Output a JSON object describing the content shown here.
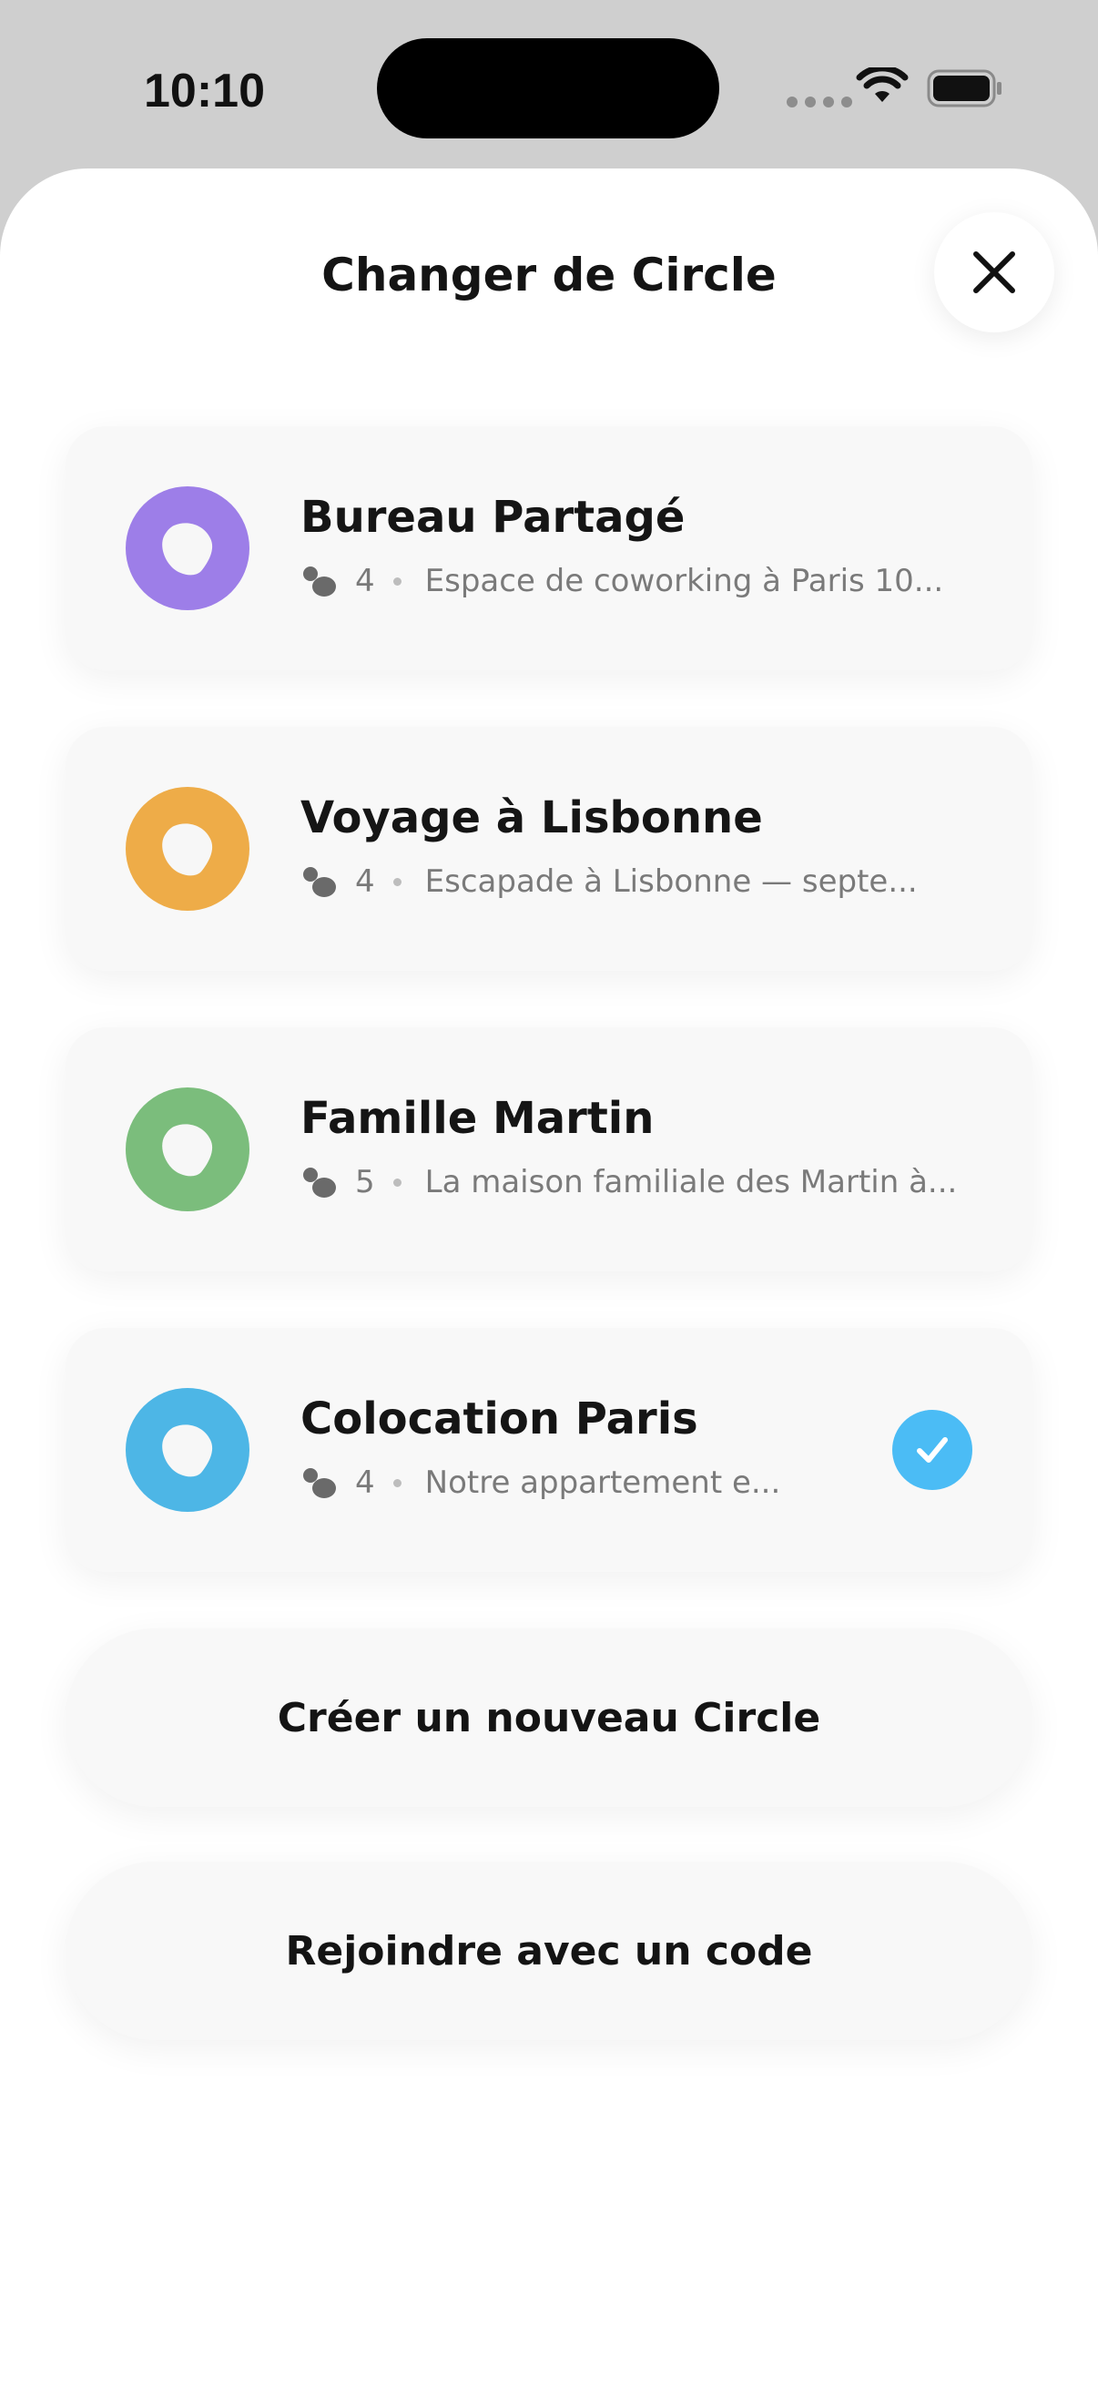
{
  "status_bar": {
    "time": "10:10"
  },
  "sheet": {
    "title": "Changer de Circle",
    "close_icon": "close-icon"
  },
  "circles": [
    {
      "name": "Bureau Partagé",
      "members": "4",
      "description": "Espace de coworking à Paris 10...",
      "color": "#9d7ee8",
      "selected": false
    },
    {
      "name": "Voyage à Lisbonne",
      "members": "4",
      "description": "Escapade à Lisbonne — septe...",
      "color": "#eeac48",
      "selected": false
    },
    {
      "name": "Famille Martin",
      "members": "5",
      "description": "La maison familiale des Martin à...",
      "color": "#7bbd7c",
      "selected": false
    },
    {
      "name": "Colocation Paris",
      "members": "4",
      "description": "Notre appartement e...",
      "color": "#4db6e6",
      "selected": true
    }
  ],
  "actions": {
    "create_label": "Créer un nouveau Circle",
    "join_label": "Rejoindre avec un code"
  },
  "colors": {
    "check_accent": "#4bbcf5",
    "sheet_background": "#ffffff",
    "card_background": "#f8f8f8"
  }
}
